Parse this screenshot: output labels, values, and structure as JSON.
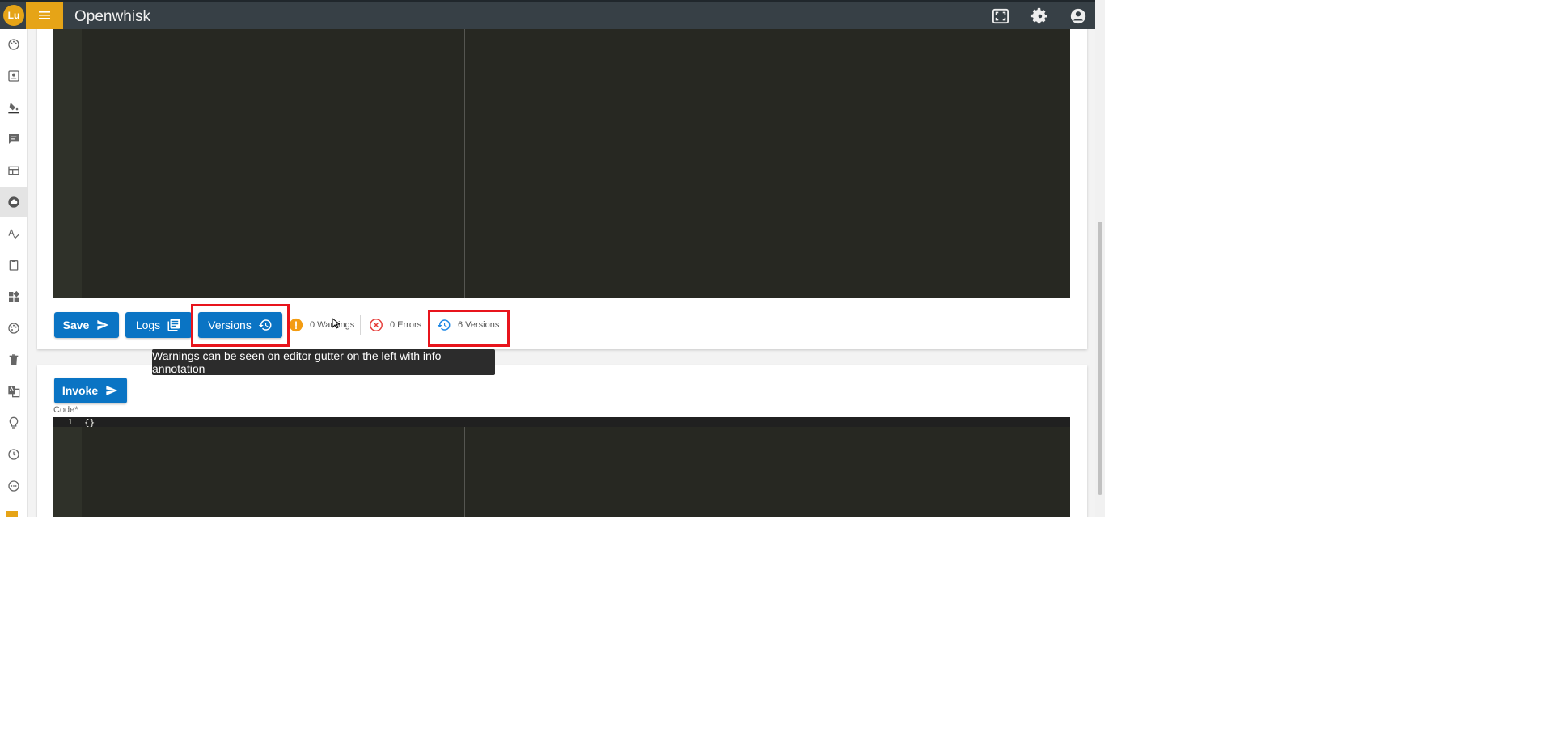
{
  "header": {
    "logo_text": "Lu",
    "title": "Openwhisk",
    "icons": [
      "fullscreen-icon",
      "settings-icon",
      "account-icon"
    ]
  },
  "sidebar": {
    "active_item": "cloud-icon",
    "icons": [
      "palette-icon",
      "contact-icon",
      "paint-bucket-icon",
      "chat-icon",
      "table-icon",
      "cloud-icon",
      "spellcheck-icon",
      "clipboard-icon",
      "dashboard-icon",
      "palette-alt-icon",
      "trash-icon",
      "translate-icon",
      "lightbulb-icon",
      "clock-icon",
      "more-icon"
    ]
  },
  "editor_panel": {
    "save_label": "Save",
    "logs_label": "Logs",
    "versions_label": "Versions",
    "warnings": "0 Warnings",
    "errors": "0 Errors",
    "versions_count": "6 Versions",
    "tooltip": "Warnings can be seen on editor gutter on the left with info annotation"
  },
  "invoke_panel": {
    "invoke_label": "Invoke",
    "code_label": "Code*",
    "code_line_number": "1",
    "code_text": "{}"
  },
  "colors": {
    "header_bg": "#374046",
    "accent": "#e6a417",
    "button_blue": "#0a74c4",
    "editor_bg": "#272822",
    "highlight_red": "#e8141c",
    "warning_orange": "#f39c12",
    "error_red": "#e53935",
    "versions_blue": "#1e88e5"
  }
}
